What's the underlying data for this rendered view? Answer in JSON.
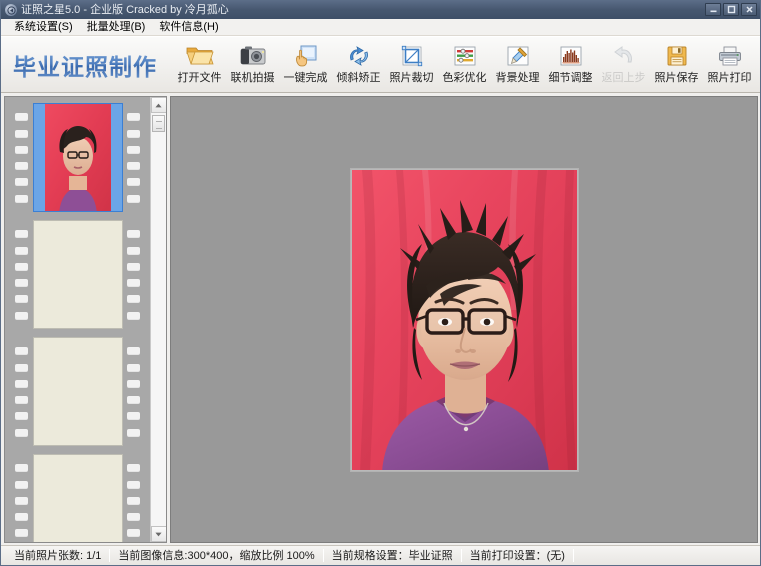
{
  "window": {
    "title": "证照之星5.0 - 企业版 Cracked by 冷月孤心",
    "icon": "app-icon",
    "controls": [
      {
        "name": "minimize",
        "label": "–"
      },
      {
        "name": "maximize",
        "label": "□"
      },
      {
        "name": "close",
        "label": "✕"
      }
    ]
  },
  "menubar": {
    "items": [
      {
        "label": "系统设置(S)",
        "accel": "S"
      },
      {
        "label": "批量处理(B)",
        "accel": "B"
      },
      {
        "label": "软件信息(H)",
        "accel": "H"
      }
    ]
  },
  "toolbar": {
    "brand": "毕业证照制作",
    "buttons": [
      {
        "label": "打开文件",
        "icon": "open-folder-icon",
        "disabled": false
      },
      {
        "label": "联机拍摄",
        "icon": "camera-icon",
        "disabled": false
      },
      {
        "label": "一键完成",
        "icon": "hand-click-icon",
        "disabled": false
      },
      {
        "label": "倾斜矫正",
        "icon": "rotate-correct-icon",
        "disabled": false
      },
      {
        "label": "照片裁切",
        "icon": "crop-icon",
        "disabled": false
      },
      {
        "label": "色彩优化",
        "icon": "color-sliders-icon",
        "disabled": false
      },
      {
        "label": "背景处理",
        "icon": "brush-icon",
        "disabled": false
      },
      {
        "label": "细节调整",
        "icon": "histogram-icon",
        "disabled": false
      },
      {
        "label": "返回上步",
        "icon": "undo-arrow-icon",
        "disabled": true
      },
      {
        "label": "照片保存",
        "icon": "save-disk-icon",
        "disabled": false
      },
      {
        "label": "照片打印",
        "icon": "printer-icon",
        "disabled": false
      }
    ]
  },
  "filmstrip": {
    "slots": [
      {
        "name": "thumbnail-1",
        "selected": true,
        "has_photo": true
      },
      {
        "name": "thumbnail-2",
        "selected": false,
        "has_photo": false
      },
      {
        "name": "thumbnail-3",
        "selected": false,
        "has_photo": false
      },
      {
        "name": "thumbnail-4",
        "selected": false,
        "has_photo": false
      }
    ],
    "scrollbar": {
      "up_arrow": "▲",
      "down_arrow": "▼"
    }
  },
  "canvas": {
    "background_color": "#999999",
    "photo_alt": "portrait-photo-red-background"
  },
  "statusbar": {
    "cells": [
      "当前照片张数: 1/1",
      "当前图像信息:300*400，缩放比例 100%",
      "当前规格设置：毕业证照",
      "当前打印设置：(无)"
    ]
  },
  "colors": {
    "titlebar": "#46576f",
    "brand_blue": "#4272b3",
    "canvas_gray": "#999999",
    "film_gray": "#a8a8a8",
    "empty_slot": "#eceadb",
    "selection_blue": "#6ba5e7",
    "photo_backdrop_red": "#e8455e"
  }
}
